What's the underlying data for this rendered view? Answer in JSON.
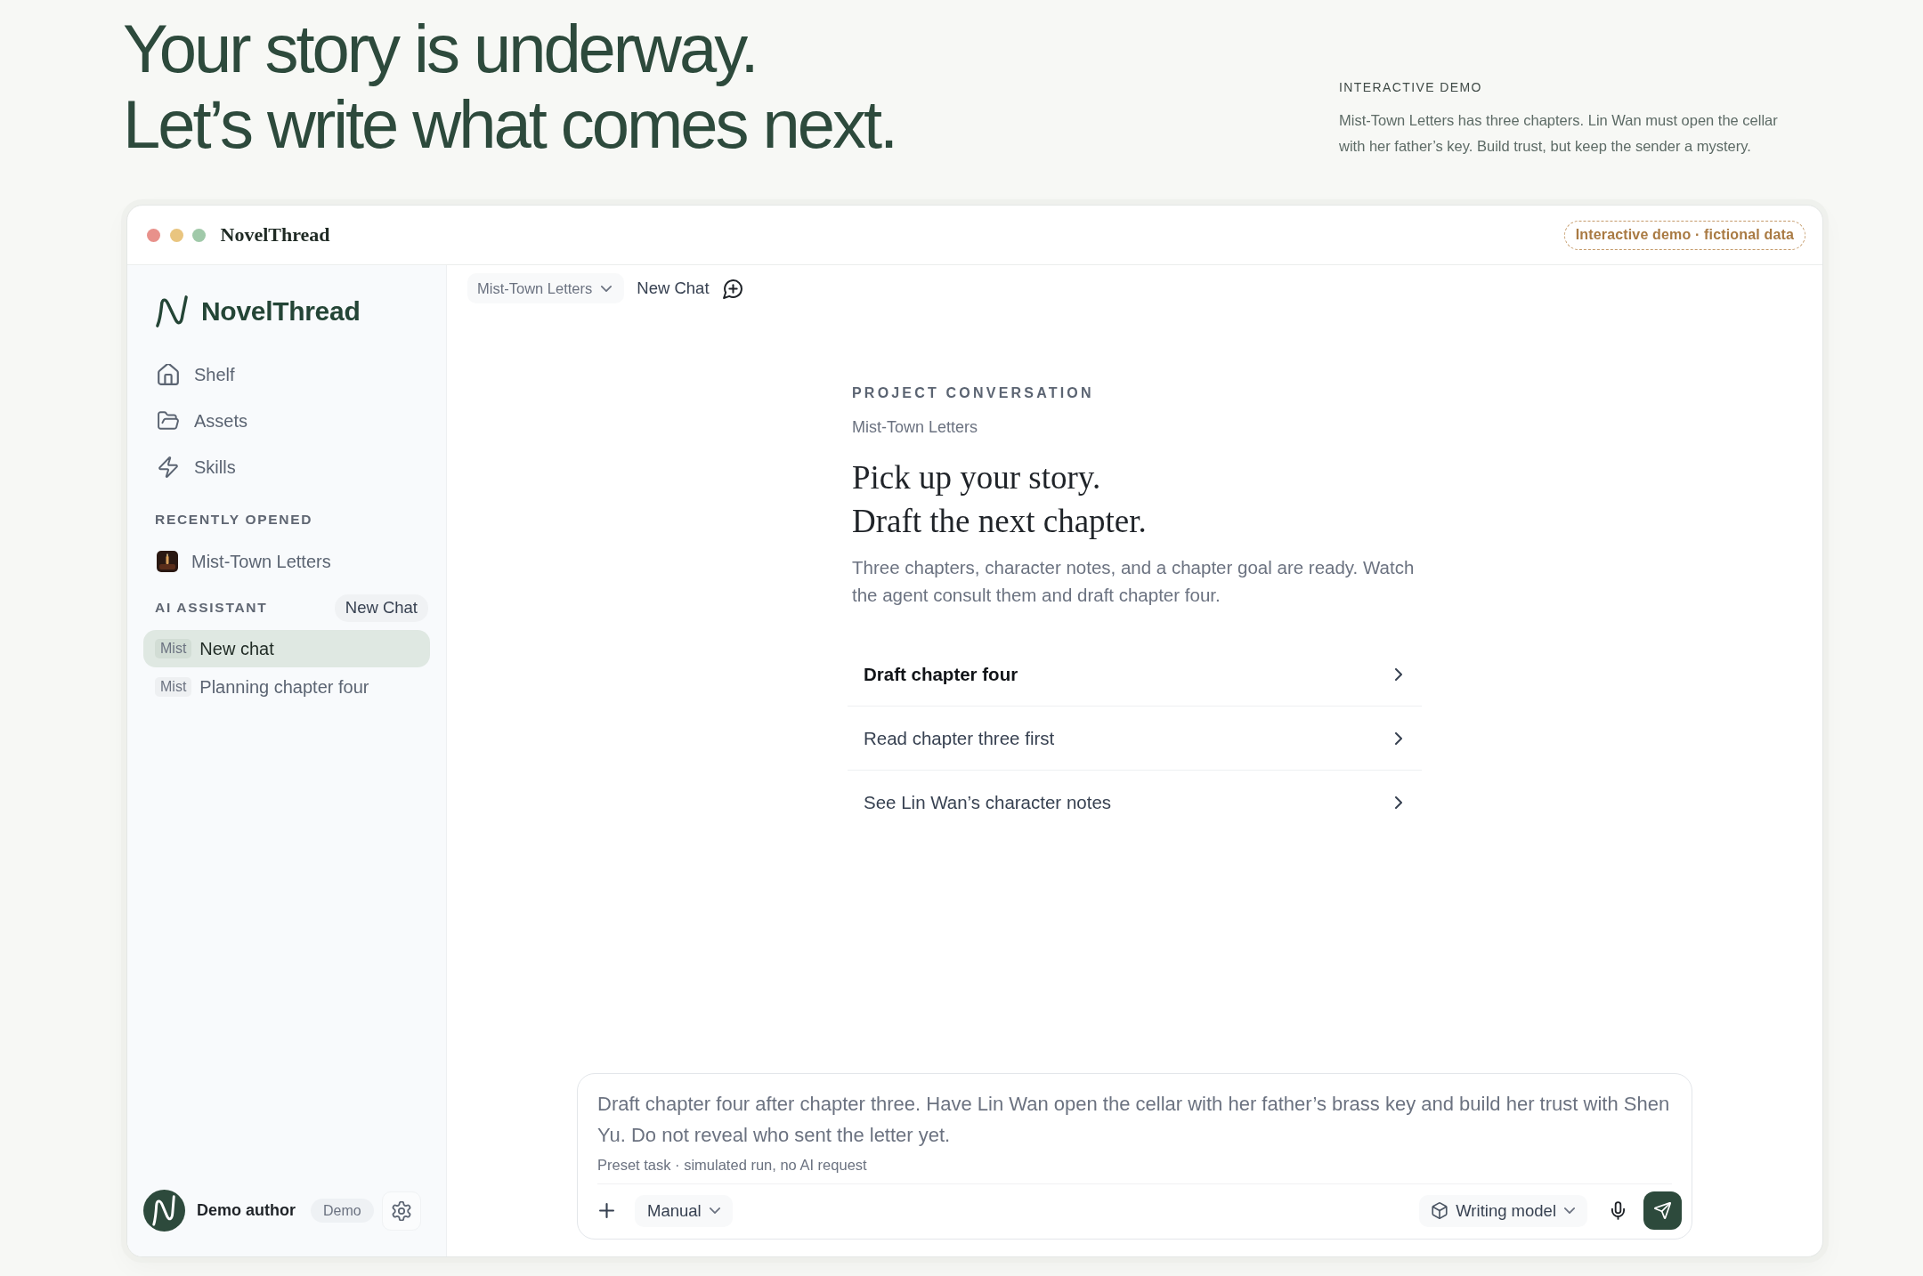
{
  "hero": {
    "title_lines": [
      "Your story is underway.",
      "Let’s write what comes next."
    ],
    "eyebrow": "INTERACTIVE DEMO",
    "description": "Mist-Town Letters has three chapters. Lin Wan must open the cellar with her father’s key. Build trust, but keep the sender a mystery."
  },
  "window": {
    "title": "NovelThread",
    "badge": "Interactive demo · fictional data"
  },
  "sidebar": {
    "brand": "NovelThread",
    "nav": [
      {
        "kind": "home",
        "label": "Shelf"
      },
      {
        "kind": "folder",
        "label": "Assets"
      },
      {
        "kind": "bolt",
        "label": "Skills"
      }
    ],
    "recent_heading": "RECENTLY OPENED",
    "recent": [
      {
        "label": "Mist-Town Letters"
      }
    ],
    "assistant_heading": "AI ASSISTANT",
    "new_chat": "New Chat",
    "chats": [
      {
        "tag": "Mist",
        "label": "New chat",
        "selected": true
      },
      {
        "tag": "Mist",
        "label": "Planning chapter four",
        "selected": false
      }
    ],
    "user": {
      "name": "Demo author",
      "badge": "Demo"
    }
  },
  "topbar": {
    "project": "Mist-Town Letters",
    "chat_title": "New Chat"
  },
  "conversation": {
    "eyebrow": "PROJECT CONVERSATION",
    "project": "Mist-Town Letters",
    "heading_lines": [
      "Pick up your story.",
      "Draft the next chapter."
    ],
    "intro": "Three chapters, character notes, and a chapter goal are ready. Watch the agent consult them and draft chapter four.",
    "suggestions": [
      {
        "label": "Draft chapter four",
        "selected": true
      },
      {
        "label": "Read chapter three first",
        "selected": false
      },
      {
        "label": "See Lin Wan’s character notes",
        "selected": false
      }
    ]
  },
  "composer": {
    "value": "Draft chapter four after chapter three. Have Lin Wan open the cellar with her father’s brass key and build her trust with Shen Yu. Do not reveal who sent the letter yet.",
    "note": "Preset task · simulated run, no AI request",
    "mode": "Manual",
    "model": "Writing model"
  }
}
